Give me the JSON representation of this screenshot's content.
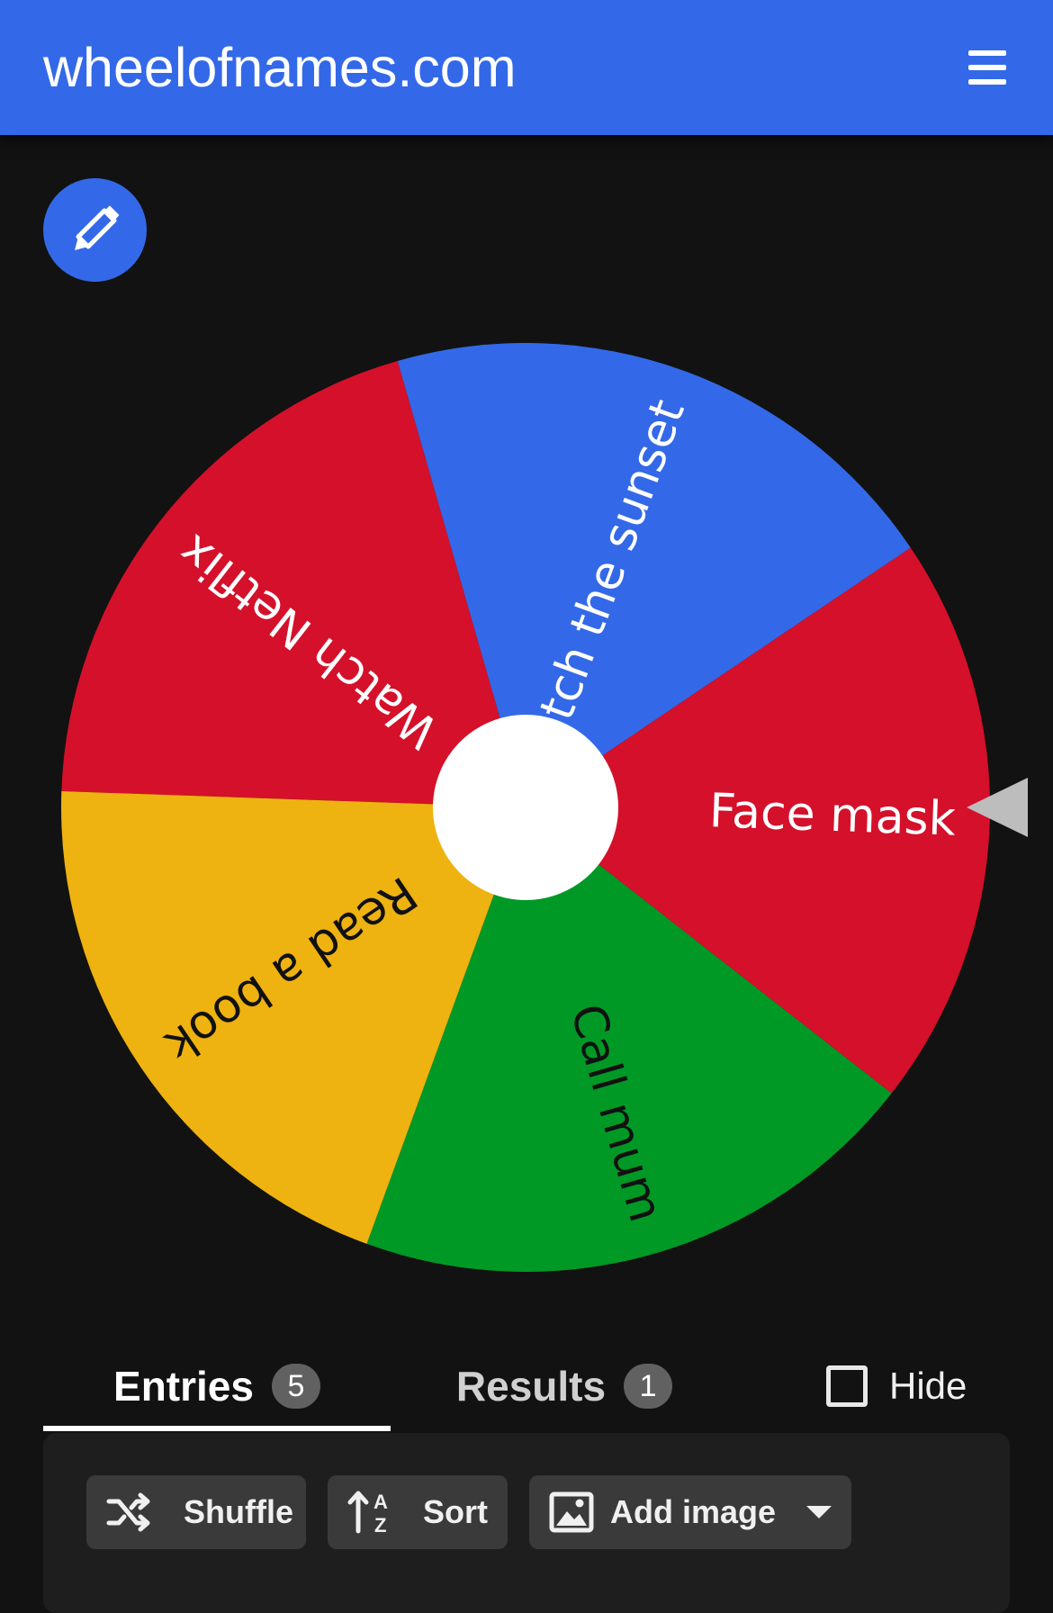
{
  "header": {
    "title": "wheelofnames.com",
    "menu_icon": "hamburger-menu-icon"
  },
  "edit_button": {
    "icon": "pencil-icon"
  },
  "wheel": {
    "segments": [
      {
        "label": "Watch Netflix",
        "color": "#d5102a",
        "text_color": "#ffffff"
      },
      {
        "label": "Watch the sunset",
        "color": "#3369e8",
        "text_color": "#ffffff"
      },
      {
        "label": "Face mask",
        "color": "#d5102a",
        "text_color": "#ffffff"
      },
      {
        "label": "Call mum",
        "color": "#009925",
        "text_color": "#111111"
      },
      {
        "label": "Read a book",
        "color": "#eeb211",
        "text_color": "#111111"
      }
    ],
    "pointer_color": "#bdbdbd"
  },
  "tabs": {
    "entries": {
      "label": "Entries",
      "count": "5"
    },
    "results": {
      "label": "Results",
      "count": "1"
    }
  },
  "hide_toggle": {
    "label": "Hide",
    "checked": false
  },
  "toolbar": {
    "shuffle": {
      "label": "Shuffle",
      "icon": "shuffle-icon"
    },
    "sort": {
      "label": "Sort",
      "icon": "sort-az-icon"
    },
    "add_image": {
      "label": "Add image",
      "icon": "image-icon",
      "dropdown_icon": "caret-down-icon"
    }
  }
}
